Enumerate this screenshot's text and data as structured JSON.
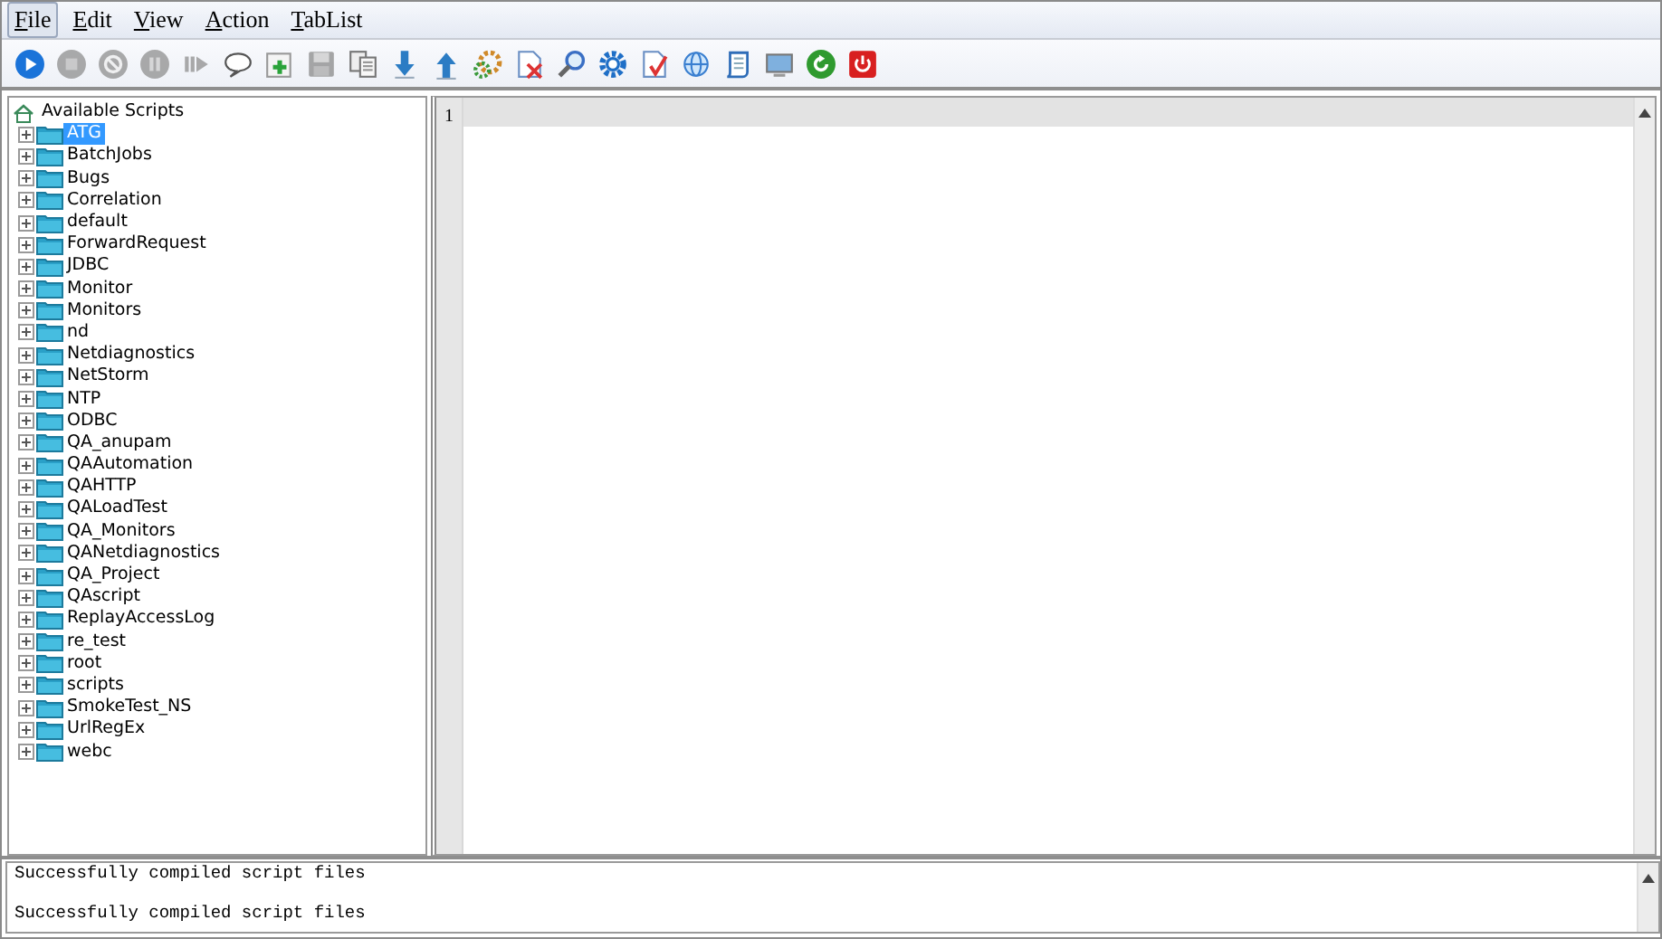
{
  "menu": [
    {
      "label": "File",
      "selected": true
    },
    {
      "label": "Edit",
      "selected": false
    },
    {
      "label": "View",
      "selected": false
    },
    {
      "label": "Action",
      "selected": false
    },
    {
      "label": "TabList",
      "selected": false
    }
  ],
  "toolbar": [
    {
      "kind": "play",
      "disabled": false
    },
    {
      "kind": "stop",
      "disabled": true
    },
    {
      "kind": "block",
      "disabled": true
    },
    {
      "kind": "pause",
      "disabled": true
    },
    {
      "kind": "step",
      "disabled": true
    },
    {
      "kind": "comment",
      "disabled": false
    },
    {
      "kind": "add",
      "disabled": false
    },
    {
      "kind": "save",
      "disabled": true
    },
    {
      "kind": "copy",
      "disabled": false
    },
    {
      "kind": "down",
      "disabled": false
    },
    {
      "kind": "up",
      "disabled": false
    },
    {
      "kind": "gears",
      "disabled": false
    },
    {
      "kind": "delete",
      "disabled": false
    },
    {
      "kind": "find",
      "disabled": false
    },
    {
      "kind": "gear",
      "disabled": false
    },
    {
      "kind": "check",
      "disabled": false
    },
    {
      "kind": "globe",
      "disabled": false
    },
    {
      "kind": "scroll",
      "disabled": false
    },
    {
      "kind": "monitor",
      "disabled": false
    },
    {
      "kind": "refresh",
      "disabled": false
    },
    {
      "kind": "power",
      "disabled": false
    }
  ],
  "tree": {
    "root": "Available Scripts",
    "items": [
      {
        "label": "ATG",
        "selected": true
      },
      {
        "label": "BatchJobs",
        "selected": false
      },
      {
        "label": "Bugs",
        "selected": false
      },
      {
        "label": "Correlation",
        "selected": false
      },
      {
        "label": "default",
        "selected": false
      },
      {
        "label": "ForwardRequest",
        "selected": false
      },
      {
        "label": "JDBC",
        "selected": false
      },
      {
        "label": "Monitor",
        "selected": false
      },
      {
        "label": "Monitors",
        "selected": false
      },
      {
        "label": "nd",
        "selected": false
      },
      {
        "label": "Netdiagnostics",
        "selected": false
      },
      {
        "label": "NetStorm",
        "selected": false
      },
      {
        "label": "NTP",
        "selected": false
      },
      {
        "label": "ODBC",
        "selected": false
      },
      {
        "label": "QA_anupam",
        "selected": false
      },
      {
        "label": "QAAutomation",
        "selected": false
      },
      {
        "label": "QAHTTP",
        "selected": false
      },
      {
        "label": "QALoadTest",
        "selected": false
      },
      {
        "label": "QA_Monitors",
        "selected": false
      },
      {
        "label": "QANetdiagnostics",
        "selected": false
      },
      {
        "label": "QA_Project",
        "selected": false
      },
      {
        "label": "QAscript",
        "selected": false
      },
      {
        "label": "ReplayAccessLog",
        "selected": false
      },
      {
        "label": "re_test",
        "selected": false
      },
      {
        "label": "root",
        "selected": false
      },
      {
        "label": "scripts",
        "selected": false
      },
      {
        "label": "SmokeTest_NS",
        "selected": false
      },
      {
        "label": "UrlRegEx",
        "selected": false
      },
      {
        "label": "webc",
        "selected": false
      }
    ]
  },
  "editor": {
    "line_numbers": [
      "1"
    ]
  },
  "console": {
    "lines": [
      "Successfully compiled script files",
      "Successfully compiled script files"
    ]
  }
}
